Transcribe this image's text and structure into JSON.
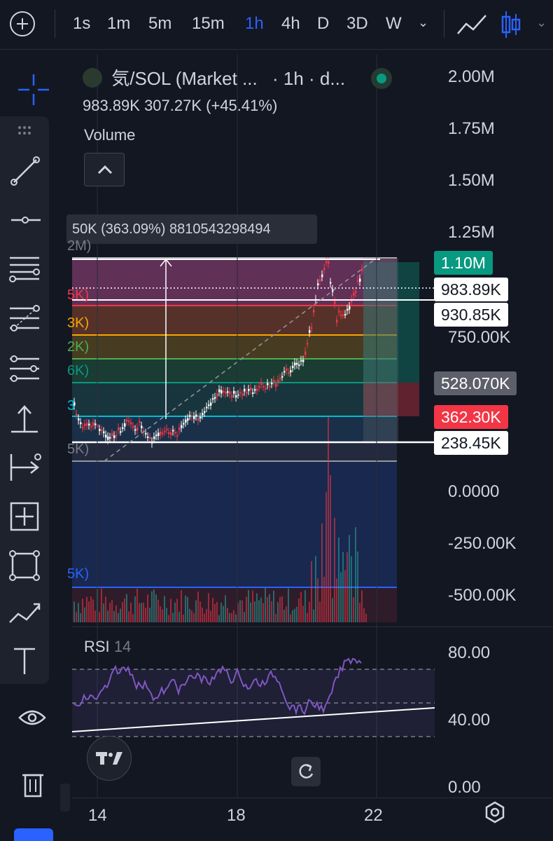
{
  "timeframes": [
    "1s",
    "1m",
    "5m",
    "15m",
    "1h",
    "4h",
    "D",
    "3D",
    "W"
  ],
  "active_timeframe": "1h",
  "header": {
    "symbol": "気/SOL (Market ...",
    "interval": "· 1h · d...",
    "price_line": "983.89K  307.27K (+45.41%)"
  },
  "volume_label": "Volume",
  "tooltip_text": "50K (363.09%) 8810543298494",
  "fib_side_labels": [
    "2M)",
    "5K)",
    "3K)",
    "2K)",
    "6K)",
    "3",
    "5K)",
    "5K)"
  ],
  "price_axis": [
    "2.00M",
    "1.75M",
    "1.50M",
    "1.25M",
    "750.00K",
    "0.0000",
    "-250.00K",
    "-500.00K"
  ],
  "price_tags": {
    "tp": "1.10M",
    "last": "983.89K",
    "alt": "930.85K",
    "entry": "528.070K",
    "stop": "362.30K",
    "low": "238.45K"
  },
  "rsi": {
    "label": "RSI",
    "period": "14",
    "axis": [
      "80.00",
      "40.00",
      "0.00"
    ]
  },
  "dates": [
    "14",
    "18",
    "22"
  ],
  "colors": {
    "bg": "#131722",
    "accent": "#2962ff",
    "up": "#26a69a",
    "down": "#f23645",
    "tp": "#089981",
    "entry": "#5d606b",
    "rsi": "#7e57c2"
  }
}
